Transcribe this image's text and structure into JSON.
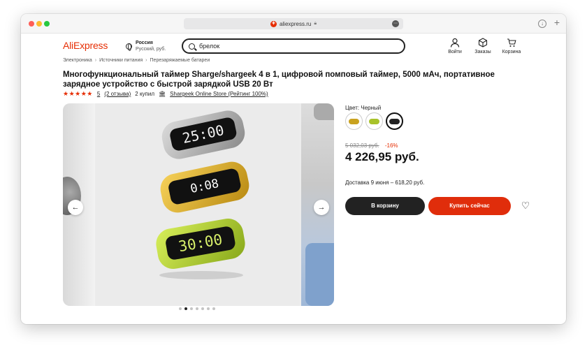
{
  "browser": {
    "url": "aliexpress.ru"
  },
  "header": {
    "logo": "AliExpress",
    "region_country": "Россия",
    "region_currency": "Русский, руб.",
    "search_value": "брелок",
    "nav": [
      {
        "label": "Войти",
        "icon": "user-icon"
      },
      {
        "label": "Заказы",
        "icon": "box-icon"
      },
      {
        "label": "Корзина",
        "icon": "cart-icon"
      }
    ]
  },
  "breadcrumb": [
    "Электроника",
    "Источники питания",
    "Перезаряжаемые батареи"
  ],
  "product": {
    "title": "Многофункциональный таймер Sharge/shargeek 4 в 1, цифровой помповый таймер, 5000 мАч, портативное зарядное устройство с быстрой зарядкой USB 20 Вт",
    "rating": "5",
    "reviews": "(2 отзыва)",
    "sold": "2 купил",
    "store": "Shargeek Online Store (Рейтинг 100%)",
    "stars": 5,
    "timer_displays": [
      "25:00",
      "0:08",
      "30:00"
    ]
  },
  "gallery": {
    "image_count": 7,
    "active_index": 1
  },
  "purchase": {
    "color_label": "Цвет: Черный",
    "swatches": [
      {
        "name": "yellow",
        "color": "#c9a21f"
      },
      {
        "name": "green",
        "color": "#a8c22a"
      },
      {
        "name": "black",
        "color": "#222222",
        "selected": true
      }
    ],
    "old_price": "5 032,03 руб.",
    "discount": "-16%",
    "price": "4 226,95 руб.",
    "delivery": "Доставка 9 июня – 618,20 руб.",
    "cart_button": "В корзину",
    "buy_button": "Купить сейчас"
  },
  "colors": {
    "brand": "#e62e04",
    "buy_button": "#e02d0b",
    "cart_button": "#222222"
  }
}
